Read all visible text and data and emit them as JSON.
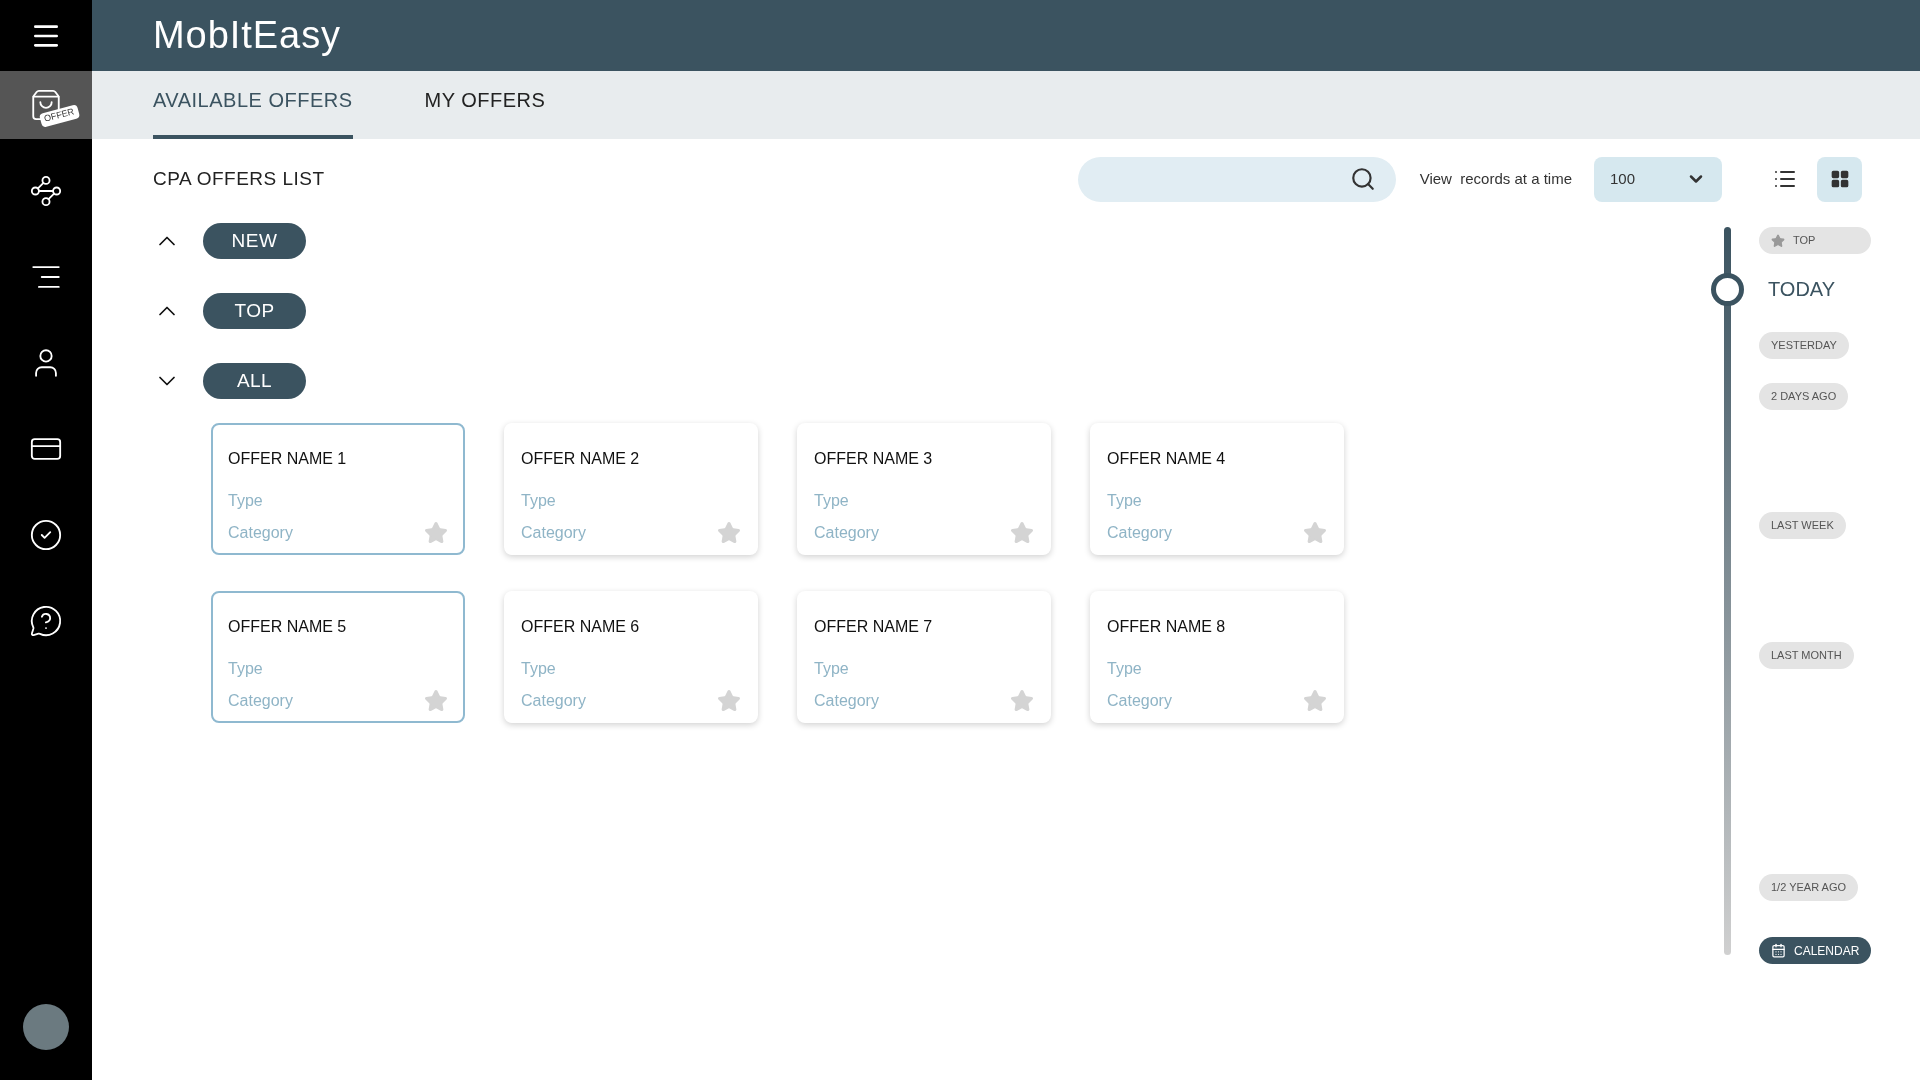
{
  "header": {
    "title": "MobItEasy"
  },
  "sidebar": {
    "items": [
      {
        "kind": "bag",
        "badge": "OFFER",
        "selected": true
      },
      {
        "kind": "network",
        "selected": false
      },
      {
        "kind": "bars",
        "selected": false
      },
      {
        "kind": "user",
        "selected": false
      },
      {
        "kind": "card",
        "selected": false
      },
      {
        "kind": "check",
        "selected": false
      },
      {
        "kind": "chat",
        "selected": false
      }
    ]
  },
  "tabs": [
    {
      "label": "AVAILABLE OFFERS",
      "selected": true
    },
    {
      "label": "MY OFFERS",
      "selected": false
    }
  ],
  "toolbar": {
    "title": "CPA OFFERS LIST",
    "view_label": "View  records at a time",
    "records": "100",
    "views": [
      {
        "kind": "list",
        "selected": false
      },
      {
        "kind": "grid",
        "selected": true
      }
    ]
  },
  "sections": [
    {
      "label": "NEW",
      "expanded": false
    },
    {
      "label": "TOP",
      "expanded": false
    },
    {
      "label": "ALL",
      "expanded": true
    }
  ],
  "offers": [
    {
      "name": "OFFER NAME 1",
      "type": "Type",
      "category": "Category",
      "selected": true
    },
    {
      "name": "OFFER NAME 2",
      "type": "Type",
      "category": "Category",
      "selected": false
    },
    {
      "name": "OFFER NAME 3",
      "type": "Type",
      "category": "Category",
      "selected": false
    },
    {
      "name": "OFFER NAME 4",
      "type": "Type",
      "category": "Category",
      "selected": false
    },
    {
      "name": "OFFER NAME 5",
      "type": "Type",
      "category": "Category",
      "selected": true
    },
    {
      "name": "OFFER NAME 6",
      "type": "Type",
      "category": "Category",
      "selected": false
    },
    {
      "name": "OFFER NAME 7",
      "type": "Type",
      "category": "Category",
      "selected": false
    },
    {
      "name": "OFFER NAME 8",
      "type": "Type",
      "category": "Category",
      "selected": false
    }
  ],
  "timeline": [
    {
      "kind": "top",
      "label": "TOP",
      "selected": false
    },
    {
      "kind": "period",
      "label": "TODAY",
      "selected": true
    },
    {
      "kind": "period",
      "label": "YESTERDAY",
      "selected": false
    },
    {
      "kind": "period",
      "label": "2 DAYS AGO",
      "selected": false
    },
    {
      "kind": "period",
      "label": "LAST WEEK",
      "selected": false
    },
    {
      "kind": "period",
      "label": "LAST MONTH",
      "selected": false
    },
    {
      "kind": "period",
      "label": "1/2 YEAR AGO",
      "selected": false
    },
    {
      "kind": "calendar",
      "label": "CALENDAR",
      "selected": false
    }
  ]
}
